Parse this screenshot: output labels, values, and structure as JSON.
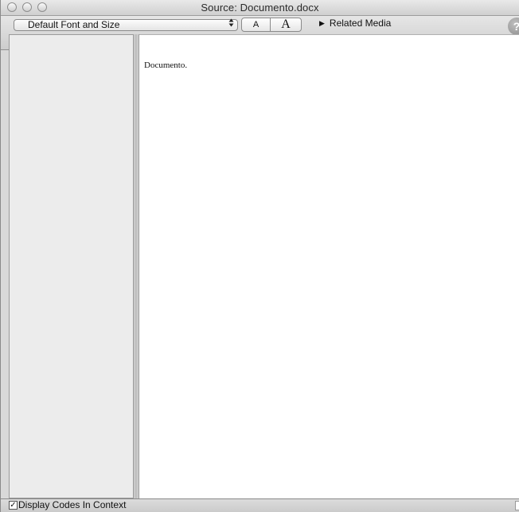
{
  "window": {
    "title": "Source: Documento.docx"
  },
  "toolbar": {
    "font_select_value": "Default Font and Size",
    "font_select_arrows": "▴▾",
    "decrease_font_label": "A",
    "increase_font_label": "A",
    "related_media_label": "Related Media",
    "related_media_icon": "disclosure-triangle-icon",
    "help_label": "?"
  },
  "document": {
    "content": "Documento."
  },
  "statusbar": {
    "display_codes_label": "Display Codes In Context",
    "display_codes_checked": true,
    "check_mark": "✓"
  }
}
